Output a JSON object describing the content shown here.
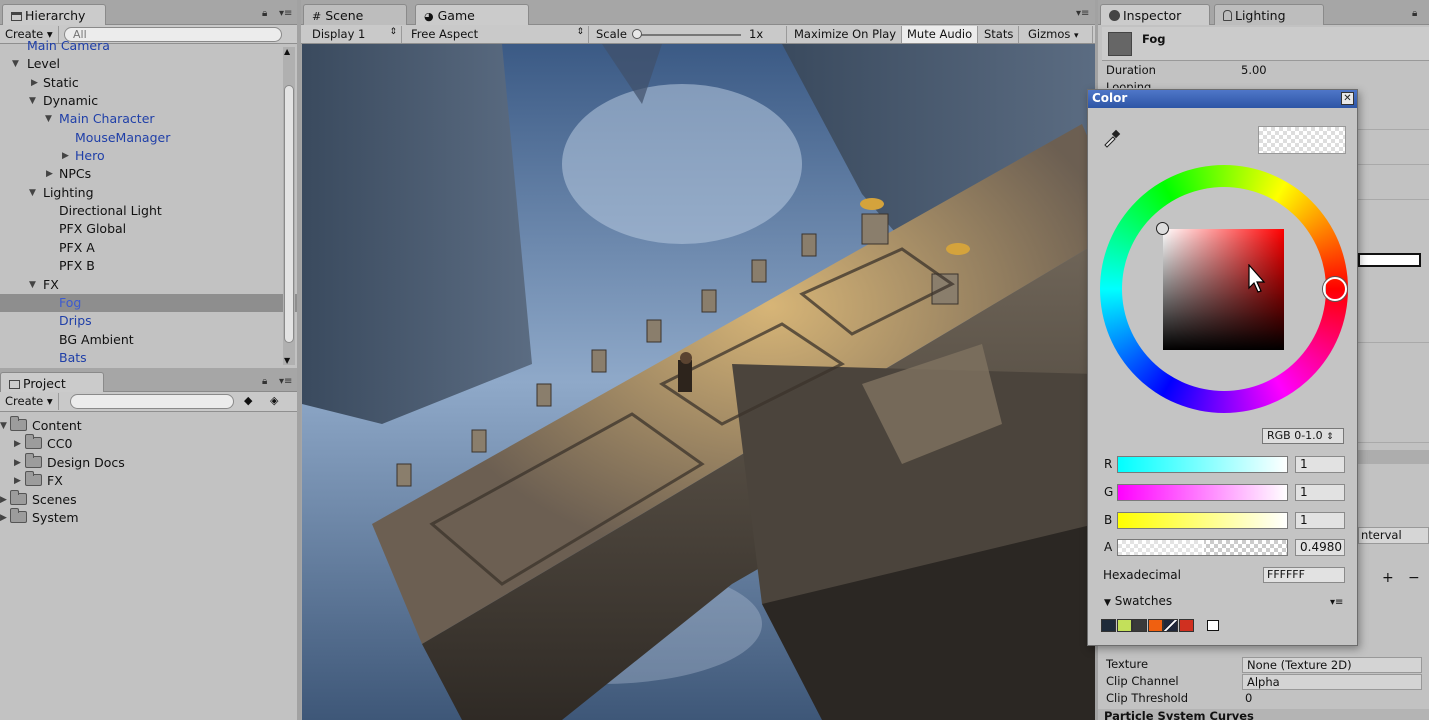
{
  "hierarchy": {
    "tab": "Hierarchy",
    "create": "Create",
    "search_placeholder": "All",
    "rows": [
      "Main Camera",
      "Level",
      "Static",
      "Dynamic",
      "Main Character",
      "MouseManager",
      "Hero",
      "NPCs",
      "Lighting",
      "Directional Light",
      "PFX Global",
      "PFX A",
      "PFX B",
      "FX",
      "Fog",
      "Drips",
      "BG Ambient",
      "Bats"
    ]
  },
  "project": {
    "tab": "Project",
    "create": "Create",
    "items": [
      "Content",
      "CC0",
      "Design Docs",
      "FX",
      "Scenes",
      "System"
    ]
  },
  "scene_tab": "Scene",
  "game": {
    "tab": "Game",
    "display": "Display 1",
    "aspect": "Free Aspect",
    "scale_label": "Scale",
    "scale_value": "1x",
    "maximize": "Maximize On Play",
    "mute": "Mute Audio",
    "stats": "Stats",
    "gizmos": "Gizmos"
  },
  "inspector": {
    "tab": "Inspector",
    "lighting_tab": "Lighting",
    "object_name": "Fog",
    "duration_label": "Duration",
    "duration_value": "5.00",
    "looping_label": "Looping",
    "interval_fragment": "nterval",
    "texture_label": "Texture",
    "texture_value": "None (Texture 2D)",
    "clip_channel_label": "Clip Channel",
    "clip_channel_value": "Alpha",
    "clip_threshold_label": "Clip Threshold",
    "clip_threshold_value": "0",
    "curves_label": "Particle System Curves"
  },
  "color_picker": {
    "title": "Color",
    "mode": "RGB 0-1.0",
    "r_label": "R",
    "r_value": "1",
    "g_label": "G",
    "g_value": "1",
    "b_label": "B",
    "b_value": "1",
    "a_label": "A",
    "a_value": "0.4980",
    "alpha_level": 0.498,
    "hex_label": "Hexadecimal",
    "hex_value": "FFFFFF",
    "swatches_label": "Swatches",
    "swatch_colors": [
      "#1e2b3a",
      "#c3e05a",
      "#3a3a3a",
      "#f06010",
      "#20283a",
      "#d03020"
    ]
  }
}
